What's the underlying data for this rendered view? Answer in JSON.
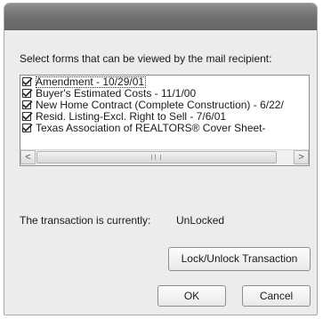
{
  "dialog": {
    "instructions": "Select forms that can be viewed by the mail recipient:",
    "forms": [
      {
        "label": "Amendment - 10/29/01",
        "checked": true,
        "focused": true
      },
      {
        "label": "Buyer's Estimated Costs - 11/1/00",
        "checked": true
      },
      {
        "label": "New Home Contract (Complete Construction) - 6/22/",
        "checked": true
      },
      {
        "label": "Resid. Listing-Excl. Right to Sell - 7/6/01",
        "checked": true
      },
      {
        "label": "Texas Association of REALTORS® Cover Sheet-",
        "checked": true
      }
    ],
    "scroll_left": "<",
    "scroll_right": ">",
    "status_label": "The transaction is currently:",
    "status_value": "UnLocked",
    "lock_button": "Lock/Unlock Transaction",
    "ok_button": "OK",
    "cancel_button": "Cancel"
  }
}
